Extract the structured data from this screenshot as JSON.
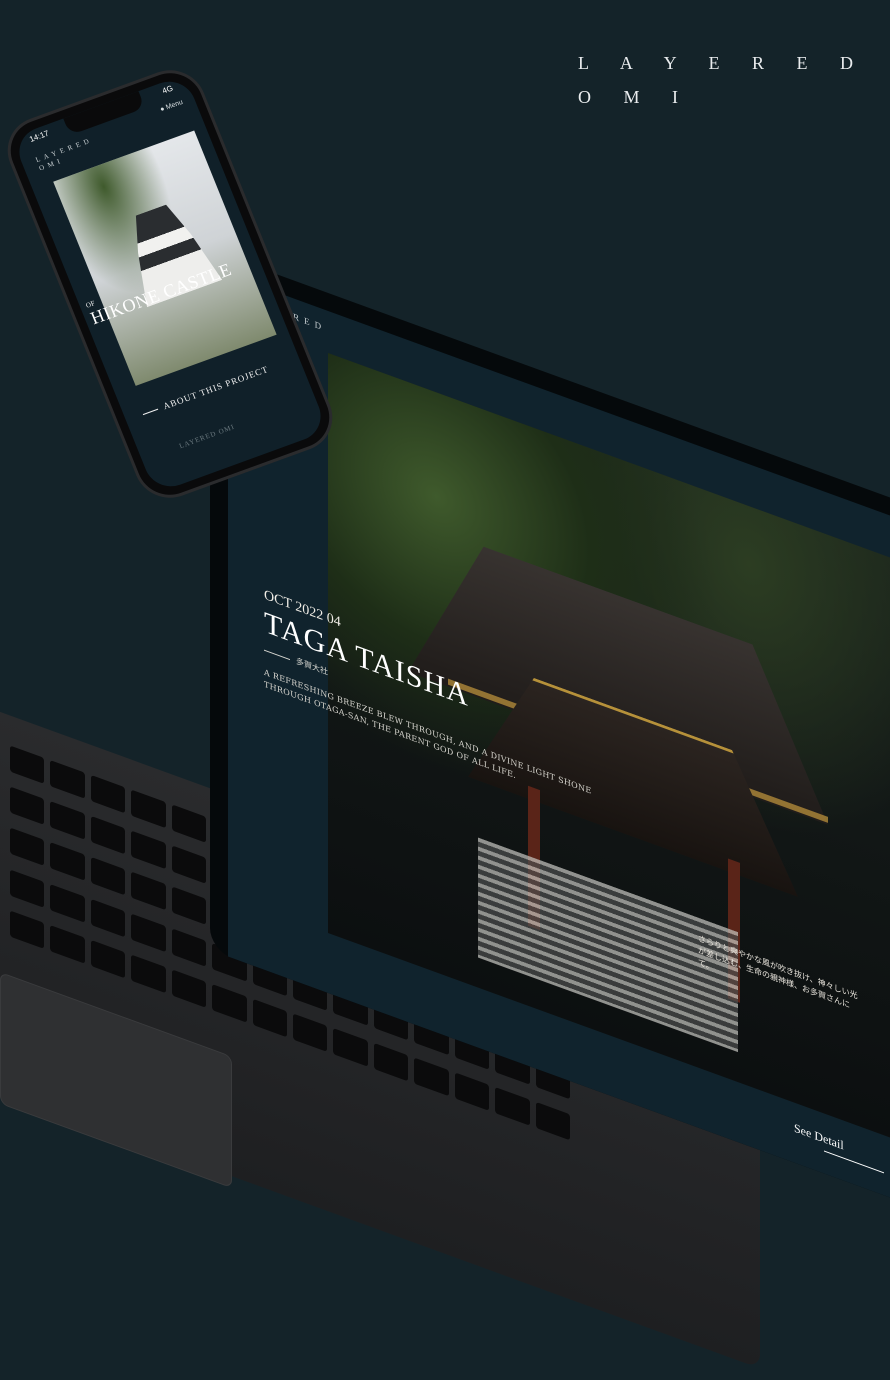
{
  "brand": {
    "line1": "L A Y E R E D",
    "line2": "O M I"
  },
  "laptop": {
    "logo_line1": "LAYERED",
    "logo_line2": "OMI",
    "date": "OCT 2022 04",
    "title": "TAGA TAISHA",
    "jp_subtitle": "多賀大社",
    "description": "A REFRESHING BREEZE BLEW THROUGH, AND A DIVINE LIGHT SHONE THROUGH OTAGA-SAN, THE PARENT GOD OF ALL LIFE.",
    "jp_overlay": "さらりと爽やかな風が吹き抜け、神々しい光が差し込む、生命の親神様、お多賀さんにて。",
    "see_detail": "See Detail"
  },
  "phone": {
    "time": "14:17",
    "network": "4G",
    "menu": "● Menu",
    "logo_line1": "LAYERED",
    "logo_line2": "OMI",
    "of_label": "OF",
    "title": "HIKONE CASTLE",
    "about": "ABOUT THIS PROJECT",
    "footer": "LAYERED OMI"
  },
  "colors": {
    "background": "#142329",
    "panel": "#10232d",
    "accent_gold": "#b08a3a"
  }
}
